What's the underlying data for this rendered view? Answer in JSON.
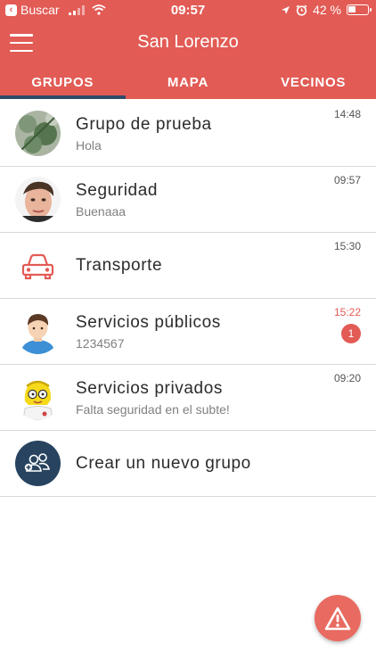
{
  "status_bar": {
    "back_label": "Buscar",
    "time": "09:57",
    "battery_text": "42 %",
    "battery_level": 0.42
  },
  "nav": {
    "title": "San Lorenzo",
    "menu_icon": "hamburger-menu-icon"
  },
  "tabs": [
    {
      "label": "GRUPOS",
      "active": true
    },
    {
      "label": "MAPA",
      "active": false
    },
    {
      "label": "VECINOS",
      "active": false
    }
  ],
  "groups": [
    {
      "title": "Grupo de prueba",
      "subtitle": "Hola",
      "time": "14:48",
      "avatar": "foliage-photo"
    },
    {
      "title": "Seguridad",
      "subtitle": "Buenaaa",
      "time": "09:57",
      "avatar": "face-photo"
    },
    {
      "title": "Transporte",
      "subtitle": "",
      "time": "15:30",
      "avatar": "car-icon"
    },
    {
      "title": "Servicios públicos",
      "subtitle": "1234567",
      "time": "15:22",
      "unread_count": "1",
      "avatar": "person-icon"
    },
    {
      "title": "Servicios privados",
      "subtitle": "Falta seguridad en el subte!",
      "time": "09:20",
      "avatar": "cartoon-avatar"
    }
  ],
  "create_group": {
    "label": "Crear un nuevo grupo",
    "icon": "add-group-icon"
  },
  "fab": {
    "icon": "alert-warning-icon"
  },
  "colors": {
    "brand": "#e25b55",
    "tab_indicator": "#2e4a68",
    "create_icon_bg": "#27435f"
  }
}
